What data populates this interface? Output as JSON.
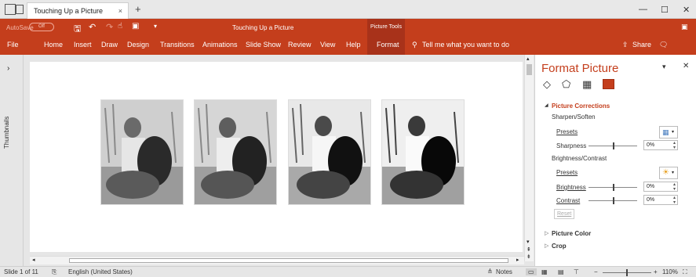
{
  "window": {
    "tab_title": "Touching Up a Picture",
    "tab_close": "×",
    "new_tab": "+",
    "minimize": "—",
    "maximize": "☐",
    "close": "✕"
  },
  "ribbon": {
    "autosave_label": "AutoSave",
    "autosave_state": "Off",
    "doc_title": "Touching Up a Picture",
    "picture_tools": "Picture Tools",
    "menu": [
      "File",
      "Home",
      "Insert",
      "Draw",
      "Design",
      "Transitions",
      "Animations",
      "Slide Show",
      "Review",
      "View",
      "Help",
      "Format"
    ],
    "tell_me": "Tell me what you want to do",
    "share": "Share",
    "accent_color": "#c43e1c"
  },
  "thumbnails": {
    "label": "Thumbnails",
    "expand": "›"
  },
  "format_panel": {
    "title": "Format Picture",
    "tab_icons": [
      "fill-line-icon",
      "effects-icon",
      "size-properties-icon",
      "picture-icon"
    ],
    "picture_corrections": "Picture Corrections",
    "sharpen_soften": "Sharpen/Soften",
    "presets_1": "Presets",
    "sharpness_label": "Sharpness",
    "sharpness_value": "0%",
    "brightness_contrast": "Brightness/Contrast",
    "presets_2": "Presets",
    "brightness_label": "Brightness",
    "brightness_value": "0%",
    "contrast_label": "Contrast",
    "contrast_value": "0%",
    "reset": "Reset",
    "picture_color": "Picture Color",
    "crop": "Crop"
  },
  "statusbar": {
    "slide_info": "Slide 1 of 11",
    "language": "English (United States)",
    "notes": "Notes",
    "zoom": "110%"
  }
}
